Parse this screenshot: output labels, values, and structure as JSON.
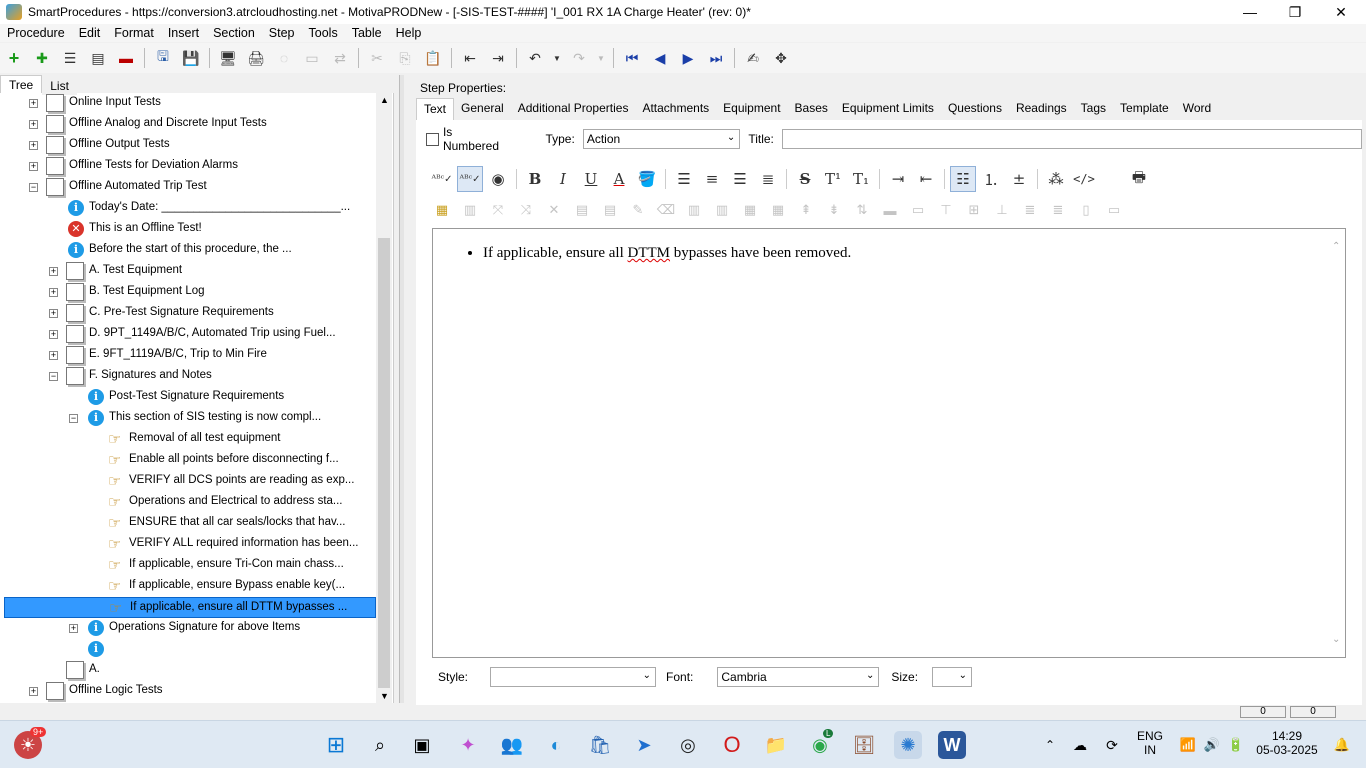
{
  "window": {
    "title": "SmartProcedures - https://conversion3.atrcloudhosting.net - MotivaPRODNew - [-SIS-TEST-####] 'I_001 RX 1A Charge Heater' (rev: 0)*",
    "minimize": "—",
    "maximize": "❐",
    "close": "✕"
  },
  "menu": [
    "Procedure",
    "Edit",
    "Format",
    "Insert",
    "Section",
    "Step",
    "Tools",
    "Table",
    "Help"
  ],
  "left_tabs": [
    "Tree",
    "List"
  ],
  "tree": [
    {
      "label": "Online Input Tests",
      "icon": "doc",
      "expander": "+",
      "indent": 0
    },
    {
      "label": "Offline Analog and Discrete Input Tests",
      "icon": "doc",
      "expander": "+",
      "indent": 0
    },
    {
      "label": "Offline Output Tests",
      "icon": "doc",
      "expander": "+",
      "indent": 0
    },
    {
      "label": "Offline Tests for Deviation Alarms",
      "icon": "doc",
      "expander": "+",
      "indent": 0
    },
    {
      "label": "Offline Automated Trip Test",
      "icon": "doc",
      "expander": "−",
      "indent": 0
    },
    {
      "label": "Today's Date: ____________________________...",
      "icon": "info",
      "expander": "",
      "indent": 1
    },
    {
      "label": "This is an Offline Test!",
      "icon": "err",
      "expander": "",
      "indent": 1
    },
    {
      "label": "Before the start of this procedure, the ...",
      "icon": "info",
      "expander": "",
      "indent": 1
    },
    {
      "label": "A. Test Equipment",
      "icon": "doc",
      "expander": "+",
      "indent": 1
    },
    {
      "label": "B. Test Equipment Log",
      "icon": "doc",
      "expander": "+",
      "indent": 1
    },
    {
      "label": "C. Pre-Test Signature Requirements",
      "icon": "doc",
      "expander": "+",
      "indent": 1
    },
    {
      "label": "D. 9PT_1149A/B/C, Automated Trip using Fuel...",
      "icon": "doc",
      "expander": "+",
      "indent": 1
    },
    {
      "label": "E. 9FT_1119A/B/C, Trip to Min Fire",
      "icon": "doc",
      "expander": "+",
      "indent": 1
    },
    {
      "label": "F. Signatures and Notes",
      "icon": "doc",
      "expander": "−",
      "indent": 1
    },
    {
      "label": "Post-Test Signature Requirements",
      "icon": "info",
      "expander": "",
      "indent": 2
    },
    {
      "label": "This section of SIS testing is now compl...",
      "icon": "info",
      "expander": "−",
      "indent": 2
    },
    {
      "label": "Removal of all test equipment",
      "icon": "hand",
      "expander": "",
      "indent": 3
    },
    {
      "label": "Enable all points before disconnecting f...",
      "icon": "hand",
      "expander": "",
      "indent": 3
    },
    {
      "label": "VERIFY all DCS points are reading as exp...",
      "icon": "hand",
      "expander": "",
      "indent": 3
    },
    {
      "label": "Operations and Electrical to address sta...",
      "icon": "hand",
      "expander": "",
      "indent": 3
    },
    {
      "label": "ENSURE that all car seals/locks that hav...",
      "icon": "hand",
      "expander": "",
      "indent": 3
    },
    {
      "label": "VERIFY ALL required information has been...",
      "icon": "hand",
      "expander": "",
      "indent": 3
    },
    {
      "label": "If applicable, ensure Tri-Con main chass...",
      "icon": "hand",
      "expander": "",
      "indent": 3
    },
    {
      "label": "If applicable, ensure Bypass enable key(...",
      "icon": "hand",
      "expander": "",
      "indent": 3
    },
    {
      "label": "If applicable, ensure all DTTM bypasses ...",
      "icon": "hand",
      "expander": "",
      "indent": 3,
      "selected": true
    },
    {
      "label": "Operations Signature for above Items",
      "icon": "info",
      "expander": "+",
      "indent": 2
    },
    {
      "label": "",
      "icon": "info",
      "expander": "",
      "indent": 2
    },
    {
      "label": "A.",
      "icon": "doc",
      "expander": "",
      "indent": 1
    },
    {
      "label": "Offline Logic Tests",
      "icon": "doc",
      "expander": "+",
      "indent": 0
    }
  ],
  "step_properties": {
    "heading": "Step Properties:",
    "tabs": [
      "Text",
      "General",
      "Additional Properties",
      "Attachments",
      "Equipment",
      "Bases",
      "Equipment Limits",
      "Questions",
      "Readings",
      "Tags",
      "Template",
      "Word"
    ],
    "is_numbered_label": "Is Numbered",
    "type_label": "Type:",
    "type_value": "Action",
    "title_label": "Title:",
    "title_value": "",
    "content_before": "If applicable, ensure all ",
    "content_misspelled": "DTTM",
    "content_after": " bypasses have been removed.",
    "style_label": "Style:",
    "style_value": "",
    "font_label": "Font:",
    "font_value": "Cambria",
    "size_label": "Size:",
    "size_value": ""
  },
  "status": {
    "a": "0",
    "b": "0"
  },
  "taskbar": {
    "notification_badge": "9+",
    "chrome_badge": "L",
    "lang_line1": "ENG",
    "lang_line2": "IN",
    "time": "14:29",
    "date": "05-03-2025"
  }
}
